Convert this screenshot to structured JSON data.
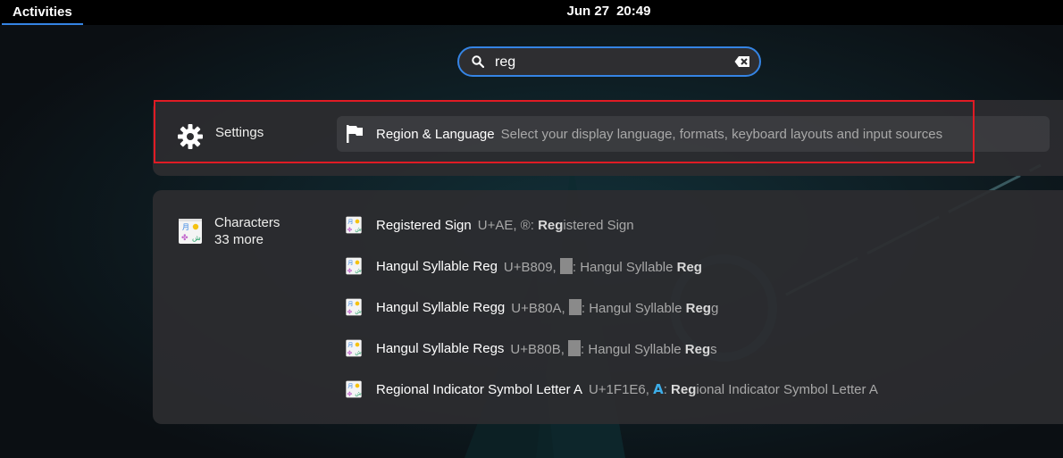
{
  "topbar": {
    "activities_label": "Activities",
    "clock_date": "Jun 27",
    "clock_time": "20:49"
  },
  "search": {
    "value": "reg",
    "placeholder": ""
  },
  "providers": {
    "settings": {
      "name": "Settings",
      "result": {
        "title": "Region & Language",
        "description": "Select your display language, formats, keyboard layouts and input sources"
      }
    },
    "characters": {
      "name": "Characters",
      "more": "33 more",
      "results": [
        {
          "title": "Registered Sign",
          "desc_prefix": "U+AE, ®: ",
          "match": "Reg",
          "desc_suffix": "istered Sign"
        },
        {
          "title": "Hangul Syllable Reg",
          "desc_prefix": "U+B809, ",
          "desc_mid": ": Hangul Syllable ",
          "match": "Reg",
          "desc_suffix": ""
        },
        {
          "title": "Hangul Syllable Regg",
          "desc_prefix": "U+B80A, ",
          "desc_mid": ": Hangul Syllable ",
          "match": "Reg",
          "desc_suffix": "g"
        },
        {
          "title": "Hangul Syllable Regs",
          "desc_prefix": "U+B80B, ",
          "desc_mid": ": Hangul Syllable ",
          "match": "Reg",
          "desc_suffix": "s"
        },
        {
          "title": "Regional Indicator Symbol Letter A",
          "desc_prefix": "U+1F1E6, ",
          "glyph": "A",
          "desc_mid": ": ",
          "match": "Reg",
          "desc_suffix": "ional Indicator Symbol Letter A"
        }
      ]
    }
  },
  "colors": {
    "accent": "#3584e4",
    "highlight": "#e01b24"
  },
  "icons": {
    "search": "search-icon",
    "clear": "clear-text-icon",
    "settings": "gear-icon",
    "region": "flag-icon",
    "characters": "characters-app-icon"
  }
}
